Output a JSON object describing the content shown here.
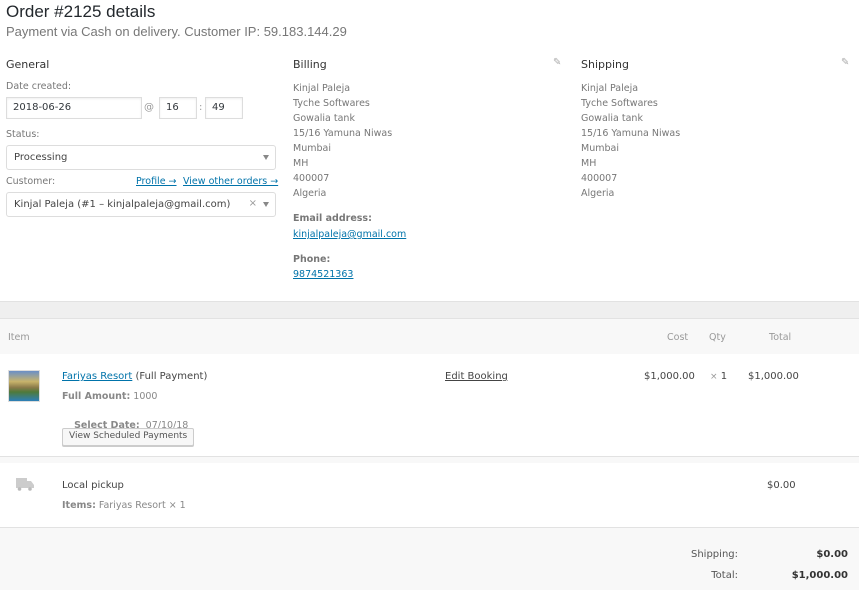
{
  "header": {
    "title": "Order #2125 details",
    "subtitle": "Payment via Cash on delivery. Customer IP: 59.183.144.29"
  },
  "general": {
    "heading": "General",
    "date_label": "Date created:",
    "date_value": "2018-06-26",
    "at_symbol": "@",
    "hour_value": "16",
    "time_sep": ":",
    "minute_value": "49",
    "status_label": "Status:",
    "status_value": "Processing",
    "customer_label": "Customer:",
    "profile_link": "Profile →",
    "other_orders_link": "View other orders →",
    "customer_value": "Kinjal Paleja (#1 – kinjalpaleja@gmail.com)",
    "clear_symbol": "×"
  },
  "billing": {
    "heading": "Billing",
    "lines": [
      "Kinjal Paleja",
      "Tyche Softwares",
      "Gowalia tank",
      "15/16 Yamuna Niwas",
      "Mumbai",
      "MH",
      "400007",
      "Algeria"
    ],
    "email_label": "Email address:",
    "email_value": "kinjalpaleja@gmail.com",
    "phone_label": "Phone:",
    "phone_value": "9874521363"
  },
  "shipping": {
    "heading": "Shipping",
    "lines": [
      "Kinjal Paleja",
      "Tyche Softwares",
      "Gowalia tank",
      "15/16 Yamuna Niwas",
      "Mumbai",
      "MH",
      "400007",
      "Algeria"
    ]
  },
  "items_table": {
    "columns": {
      "item": "Item",
      "cost": "Cost",
      "qty": "Qty",
      "total": "Total"
    },
    "line_item": {
      "name": "Fariyas Resort",
      "suffix": " (Full Payment)",
      "meta": [
        {
          "key": "Full Amount:",
          "value": " 1000"
        },
        {
          "key": "Select Date:",
          "value": "  07/10/18"
        }
      ],
      "button_label": "View Scheduled Payments",
      "edit_link": "Edit Booking",
      "cost": "$1,000.00",
      "qty_prefix": "×",
      "qty": "1",
      "total": "$1,000.00"
    },
    "shipping_line": {
      "method": "Local pickup",
      "items_key": "Items:",
      "items_value": " Fariyas Resort × 1",
      "total": "$0.00"
    }
  },
  "totals": {
    "shipping_label": "Shipping:",
    "shipping_value": "$0.00",
    "total_label": "Total:",
    "total_value": "$1,000.00"
  },
  "colors": {
    "link": "#0073aa",
    "title": "#23282d"
  }
}
